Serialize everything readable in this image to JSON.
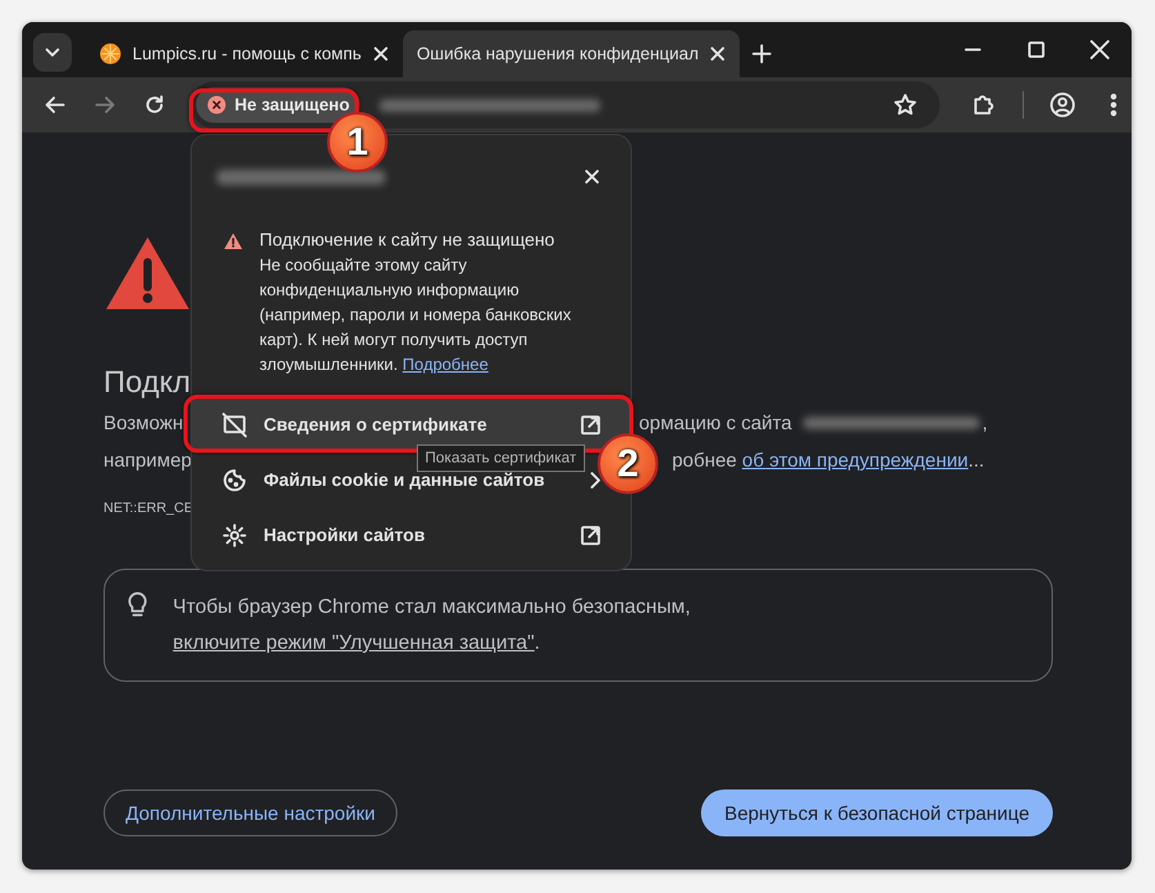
{
  "tabs": [
    {
      "title": "Lumpics.ru - помощь с компь",
      "selected": false
    },
    {
      "title": "Ошибка нарушения конфиденциал",
      "selected": true
    }
  ],
  "address_bar": {
    "security_chip": "Не защищено"
  },
  "page": {
    "title": "Подкл",
    "line_1_left": "Возможн",
    "line_1_right": "ормацию с сайта",
    "line_1_end": ",",
    "line_2_left": "например",
    "line_2_right": "робнее",
    "line_2_link": "об этом предупреждении",
    "line_2_end": "...",
    "error_code": "NET::ERR_CE"
  },
  "tip": {
    "text": "Чтобы браузер Chrome стал максимально безопасным, ",
    "link": "включите режим \"Улучшенная защита\"",
    "end": "."
  },
  "buttons": {
    "advanced": "Дополнительные настройки",
    "back": "Вернуться к безопасной странице"
  },
  "popup": {
    "heading": "Подключение к сайту не защищено",
    "body": "Не сообщайте этому сайту конфиденциальную информацию (например, пароли и номера банковских карт). К ней могут получить доступ злоумышленники. ",
    "more_link": "Подробнее",
    "items": [
      {
        "label": "Сведения о сертификате",
        "kind": "external",
        "hovered": true
      },
      {
        "label": "Файлы cookie и данные сайтов",
        "kind": "submenu",
        "hovered": false
      },
      {
        "label": "Настройки сайтов",
        "kind": "external",
        "hovered": false
      }
    ]
  },
  "tooltip": "Показать сертификат",
  "annotations": [
    {
      "label": "1"
    },
    {
      "label": "2"
    }
  ]
}
